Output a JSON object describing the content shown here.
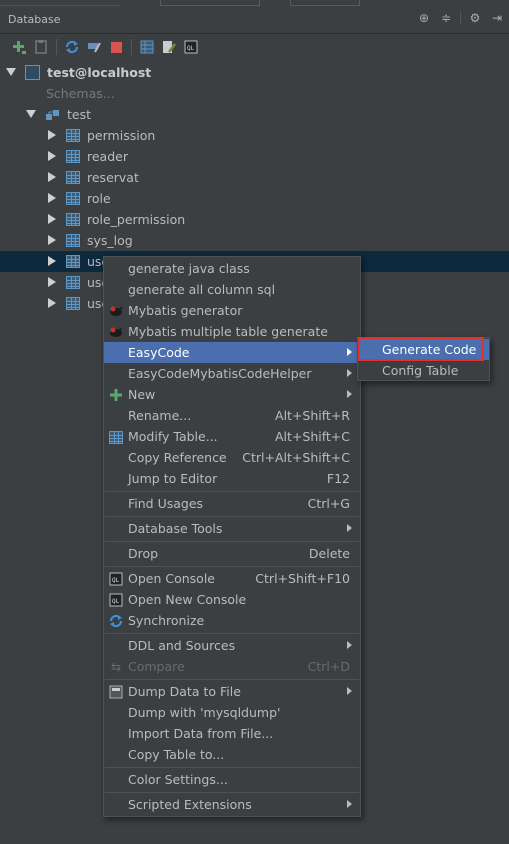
{
  "titlebar": {
    "title": "Database"
  },
  "toolbar": {
    "items": [
      "add-icon",
      "properties-icon",
      "refresh-icon",
      "edit-connection-icon",
      "stop-icon",
      "table-view-icon",
      "edit-source-icon",
      "console-icon"
    ]
  },
  "tree": {
    "connection": "test@localhost",
    "schemas_label": "Schemas...",
    "schema": "test",
    "tables": [
      "permission",
      "reader",
      "reservat",
      "role",
      "role_permission",
      "sys_log",
      "use",
      "use",
      "use"
    ]
  },
  "menu": {
    "items": [
      {
        "label": "generate java class",
        "shortcut": ""
      },
      {
        "label": "generate all column sql",
        "shortcut": ""
      },
      {
        "label": "Mybatis generator",
        "shortcut": ""
      },
      {
        "label": "Mybatis multiple table generate",
        "shortcut": ""
      },
      {
        "label": "EasyCode",
        "shortcut": ""
      },
      {
        "label": "EasyCodeMybatisCodeHelper",
        "shortcut": ""
      },
      {
        "label": "New",
        "shortcut": ""
      },
      {
        "label": "Rename...",
        "shortcut": "Alt+Shift+R"
      },
      {
        "label": "Modify Table...",
        "shortcut": "Alt+Shift+C"
      },
      {
        "label": "Copy Reference",
        "shortcut": "Ctrl+Alt+Shift+C"
      },
      {
        "label": "Jump to Editor",
        "shortcut": "F12"
      },
      {
        "label": "Find Usages",
        "shortcut": "Ctrl+G"
      },
      {
        "label": "Database Tools",
        "shortcut": ""
      },
      {
        "label": "Drop",
        "shortcut": "Delete"
      },
      {
        "label": "Open Console",
        "shortcut": "Ctrl+Shift+F10"
      },
      {
        "label": "Open New Console",
        "shortcut": ""
      },
      {
        "label": "Synchronize",
        "shortcut": ""
      },
      {
        "label": "DDL and Sources",
        "shortcut": ""
      },
      {
        "label": "Compare",
        "shortcut": "Ctrl+D"
      },
      {
        "label": "Dump Data to File",
        "shortcut": ""
      },
      {
        "label": "Dump with 'mysqldump'",
        "shortcut": ""
      },
      {
        "label": "Import Data from File...",
        "shortcut": ""
      },
      {
        "label": "Copy Table to...",
        "shortcut": ""
      },
      {
        "label": "Color Settings...",
        "shortcut": ""
      },
      {
        "label": "Scripted Extensions",
        "shortcut": ""
      }
    ]
  },
  "submenu": {
    "items": [
      {
        "label": "Generate Code"
      },
      {
        "label": "Config Table"
      }
    ]
  },
  "colors": {
    "highlight": "#4b6eaf",
    "annotation": "#e0312f",
    "background": "#3c3f41"
  }
}
